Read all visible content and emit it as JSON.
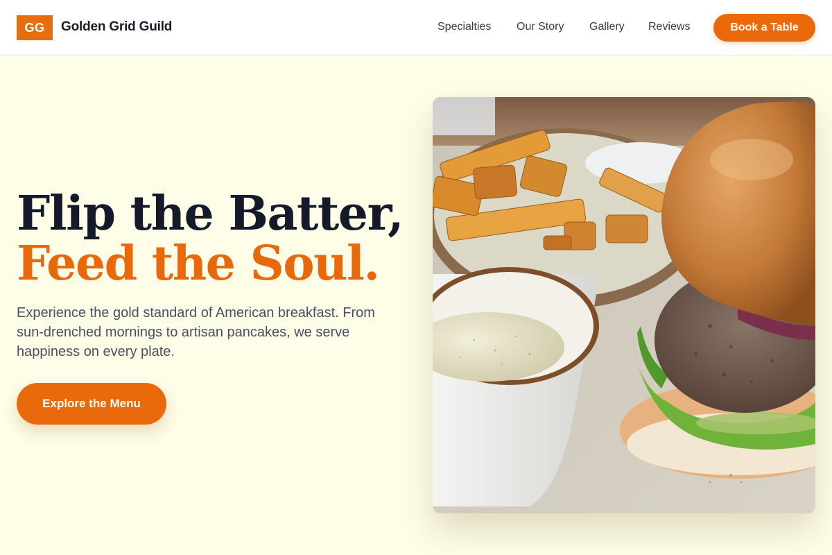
{
  "header": {
    "logo_text": "GG",
    "brand_name": "Golden Grid Guild",
    "nav": [
      "Specialties",
      "Our Story",
      "Gallery",
      "Reviews"
    ],
    "cta_label": "Book a Table"
  },
  "hero": {
    "headline_line1": "Flip the Batter,",
    "headline_line2": "Feed the Soul.",
    "subtitle": "Experience the gold standard of American breakfast. From sun-drenched mornings to artisan pancakes, we serve happiness on every plate.",
    "cta_label": "Explore the Menu",
    "image_subject": "burger-fries-dip-photo"
  },
  "colors": {
    "accent": "#ea6a0b",
    "heading_dark": "#141a2a",
    "background": "#fefde8"
  }
}
